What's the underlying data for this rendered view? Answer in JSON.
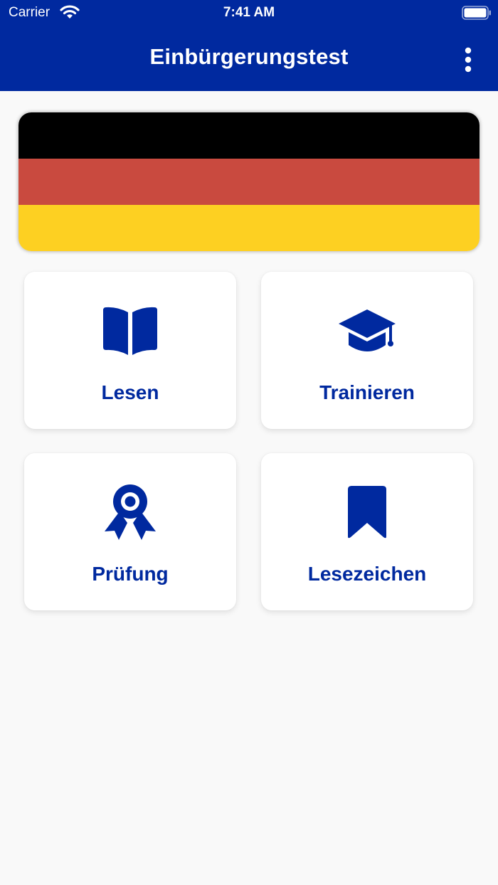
{
  "status_bar": {
    "carrier": "Carrier",
    "time": "7:41 AM",
    "wifi_icon": "wifi-icon",
    "battery_icon": "battery-icon"
  },
  "header": {
    "title": "Einbürgerungstest",
    "menu_icon": "more-vertical-icon"
  },
  "colors": {
    "primary": "#00299f",
    "background": "#f9f9f9",
    "flag_black": "#000000",
    "flag_red": "#c94a3f",
    "flag_gold": "#fdd022"
  },
  "menu": {
    "items": [
      {
        "label": "Lesen",
        "icon": "book-icon"
      },
      {
        "label": "Trainieren",
        "icon": "graduation-cap-icon"
      },
      {
        "label": "Prüfung",
        "icon": "award-icon"
      },
      {
        "label": "Lesezeichen",
        "icon": "bookmark-icon"
      }
    ]
  }
}
